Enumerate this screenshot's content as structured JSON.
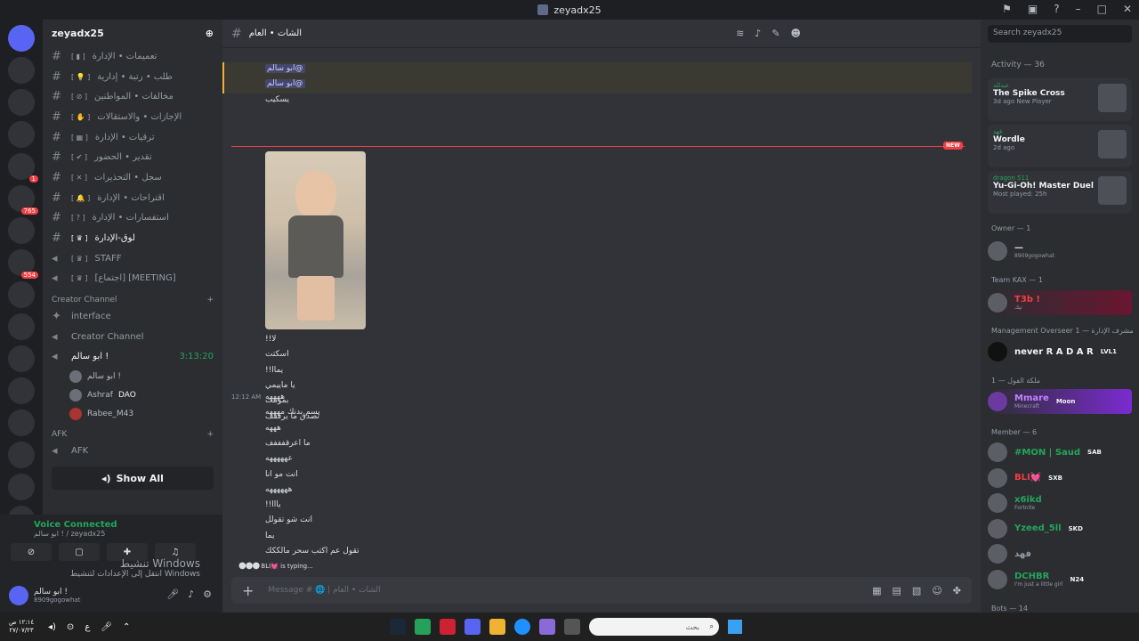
{
  "window": {
    "title": "zeyadx25"
  },
  "server": {
    "name": "zeyadx25"
  },
  "channels": [
    {
      "name": "تعميمات • الإدارة",
      "type": "text"
    },
    {
      "name": "طلب • رتبة • إدارية",
      "type": "text"
    },
    {
      "name": "مخالفات • المواطنين",
      "type": "text"
    },
    {
      "name": "الإجازات • والاستقالات",
      "type": "text"
    },
    {
      "name": "ترقيات • الإدارة",
      "type": "text"
    },
    {
      "name": "تقدير • الحضور",
      "type": "text"
    },
    {
      "name": "سجل • التحذيرات",
      "type": "text"
    },
    {
      "name": "اقتراحات • الإدارة",
      "type": "text"
    },
    {
      "name": "استفسارات • الإدارة",
      "type": "text"
    },
    {
      "name": "لوق-الإدارة",
      "type": "text"
    },
    {
      "name": "STAFF",
      "type": "voice"
    },
    {
      "name": "[اجتماع] [MEETING]",
      "type": "voice"
    }
  ],
  "creator": {
    "category": "Creator Channel",
    "ch1": "interface",
    "ch2": "Creator Channel",
    "vc_name": "ابو سالم !",
    "vc_time": "3:13:20",
    "users": [
      "ابو سالم !",
      "Ashraf",
      "Rabee_M43"
    ],
    "dao": "DAO",
    "afk_cat": "AFK",
    "afk_ch": "AFK",
    "show_all": "Show All"
  },
  "voice": {
    "status": "Voice Connected",
    "sub": "ابو سالم ! / zeyadx25",
    "user": "ابو سالم !",
    "user_sub": "8909gogowhat"
  },
  "watermark": {
    "line1": "تنشيط Windows",
    "line2": "انتقل إلى الإعدادات لتنشيط Windows"
  },
  "chat": {
    "channel": "الشات • العام",
    "m1": "@ابو سالم",
    "m2": "@ابو سالم",
    "m3": "يسكيب",
    "new": "NEW",
    "lines": [
      "لا!!",
      "اسكتت",
      "يماا!!",
      "يا ماييمي",
      "بموتتت",
      "تصدق ما يرقفف"
    ],
    "time": "12:12 AM",
    "lines2": [
      "ههههه",
      "يسم بدنك مهههه",
      "هههه",
      "ما اعرقفففف",
      "عهههههه",
      "انت مو انا",
      "ههههههه",
      "يااا!!",
      "انت شو تقولل",
      "يما",
      "تقول عم اكتب سحر مالككك"
    ],
    "typing": "BLI💓 is typing...",
    "placeholder": "Message # 🌐 | الشات • العام"
  },
  "members": {
    "search": "Search zeyadx25",
    "activity": "Activity — 36",
    "acts": [
      {
        "name": "عبدلله",
        "game": "The Spike Cross",
        "time": "3d ago",
        "extra": "New Player"
      },
      {
        "name": "فهد",
        "game": "Wordle",
        "time": "2d ago",
        "extra": ""
      },
      {
        "name": "dragon 511",
        "game": "Yu-Gi-Oh! Master Duel",
        "time": "Most played: 25h",
        "extra": ""
      }
    ],
    "owner_head": "Owner — 1",
    "owner_name": "—",
    "owner_sub": "8909gogowhat",
    "team_head": "Team KAX — 1",
    "team_name": "T3b !",
    "team_sub": "تيك",
    "mgmt_head": "Management Overseer مشرف الإدارة — 1",
    "mgmt_name": "never R A D A R",
    "mgmt_tag": "LVL1",
    "malek_head": "ملكة الفول — 1",
    "malek_name": "Mmare",
    "malek_tag": "Moon",
    "malek_sub": "Minecraft",
    "member_head": "Member — 6",
    "m_names": [
      "#MON | Saud",
      "BLI💓",
      "x6ikd",
      "Yzeed_5ll",
      "فهد",
      "DCHBR"
    ],
    "m_tags": [
      "SAB",
      "SXB",
      "",
      "SKD",
      "",
      "N24"
    ],
    "m_subs": [
      "",
      "",
      "Fortnite",
      "",
      "",
      "I'm just a little girl"
    ],
    "bots_head": "Bots — 14"
  },
  "taskbar": {
    "time": "١٢:١٤ ص",
    "date": "٢٧/٠٧/٢٣",
    "search": "بحث",
    "lang": "ع"
  }
}
